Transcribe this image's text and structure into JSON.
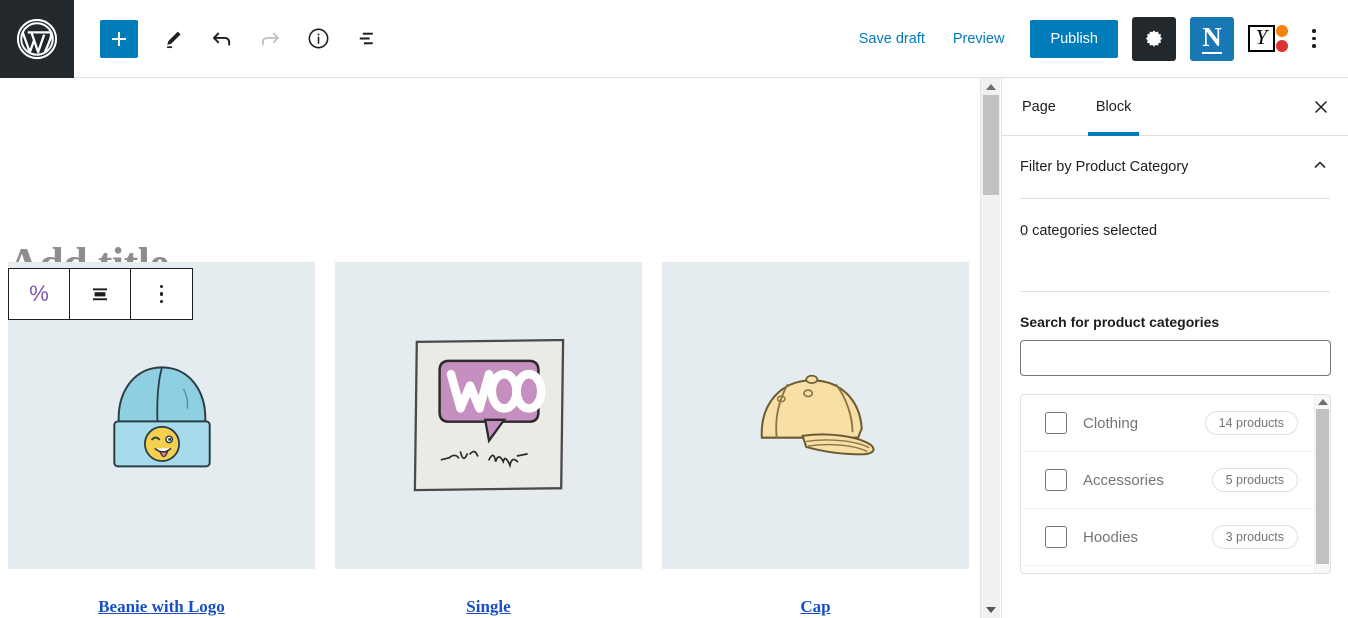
{
  "topbar": {
    "logo_icon": "wordpress-logo-icon",
    "add_block_icon": "plus-icon",
    "edit_icon": "pencil-icon",
    "undo_icon": "undo-arrow-icon",
    "redo_icon": "redo-arrow-icon",
    "info_icon": "info-circle-icon",
    "list_view_icon": "list-view-icon",
    "save_draft_label": "Save draft",
    "preview_label": "Preview",
    "publish_label": "Publish",
    "settings_icon": "gear-icon",
    "n_plugin_letter": "N",
    "yoast_letter": "Y",
    "options_icon": "kebab-menu-icon",
    "accent_color": "#007cba",
    "yoast_dot_orange": "#f5820b",
    "yoast_dot_red": "#dc3232"
  },
  "editor": {
    "title_placeholder": "Add title",
    "block_toolbar": {
      "percent_icon": "%",
      "align_icon": "align-center-icon",
      "more_icon": "kebab-menu-icon"
    },
    "products": [
      {
        "title": "Beanie with Logo",
        "image_alt": "blue-beanie-with-emoji-patch",
        "bg": "#e5ecf0"
      },
      {
        "title": "Single",
        "image_alt": "woo-single-album-cover",
        "bg": "#e5ecf0"
      },
      {
        "title": "Cap",
        "image_alt": "yellow-baseball-cap",
        "bg": "#e5ecf0"
      }
    ],
    "link_color": "#1a4fc4"
  },
  "sidebar": {
    "tabs": [
      {
        "label": "Page",
        "active": false
      },
      {
        "label": "Block",
        "active": true
      }
    ],
    "close_icon": "close-x-icon",
    "panel": {
      "title": "Filter by Product Category",
      "chevron_icon": "chevron-up-icon",
      "selected_text": "0 categories selected",
      "search_label": "Search for product categories",
      "search_value": "",
      "search_placeholder": ""
    },
    "categories": [
      {
        "name": "Clothing",
        "count_label": "14 products",
        "checked": false
      },
      {
        "name": "Accessories",
        "count_label": "5 products",
        "checked": false
      },
      {
        "name": "Hoodies",
        "count_label": "3 products",
        "checked": false
      }
    ]
  }
}
